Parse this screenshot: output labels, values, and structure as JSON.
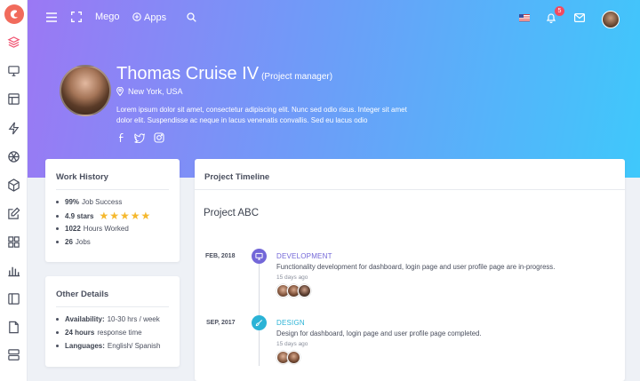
{
  "topbar": {
    "brand": "Mego",
    "apps_label": "Apps",
    "notification_count": "5"
  },
  "profile": {
    "name": "Thomas Cruise IV",
    "role": "(Project manager)",
    "location": "New York, USA",
    "bio": "Lorem ipsum dolor sit amet, consectetur adipiscing elit. Nunc sed odio risus. Integer sit amet dolor elit. Suspendisse ac neque in lacus venenatis convallis. Sed eu lacus odio"
  },
  "work_history": {
    "title": "Work History",
    "items": [
      {
        "value": "99%",
        "label": "Job Success"
      },
      {
        "value": "4.9 stars",
        "label": "",
        "stars": 5
      },
      {
        "value": "1022",
        "label": "Hours Worked"
      },
      {
        "value": "26",
        "label": "Jobs"
      }
    ]
  },
  "other_details": {
    "title": "Other Details",
    "items": [
      {
        "key": "Availability:",
        "value": "10-30 hrs / week"
      },
      {
        "key": "24 hours",
        "value": "response time"
      },
      {
        "key": "Languages:",
        "value": "English/ Spanish"
      }
    ]
  },
  "timeline": {
    "title": "Project Timeline",
    "project": "Project ABC",
    "entries": [
      {
        "date": "FEB, 2018",
        "title": "DEVELOPMENT",
        "description": "Functionality development for dashboard, login page and user profile page are in-progress.",
        "time": "15 days ago",
        "color": "#7367d8",
        "icon": "monitor-icon"
      },
      {
        "date": "SEP, 2017",
        "title": "DESIGN",
        "description": "Design for dashboard, login page and user profile page completed.",
        "time": "15 days ago",
        "color": "#2bb3d6",
        "icon": "brush-icon"
      }
    ]
  },
  "colors": {
    "accent": "#f0506e",
    "gradient_start": "#9b78f4",
    "gradient_end": "#3fc8fb",
    "star": "#f5b82e"
  }
}
